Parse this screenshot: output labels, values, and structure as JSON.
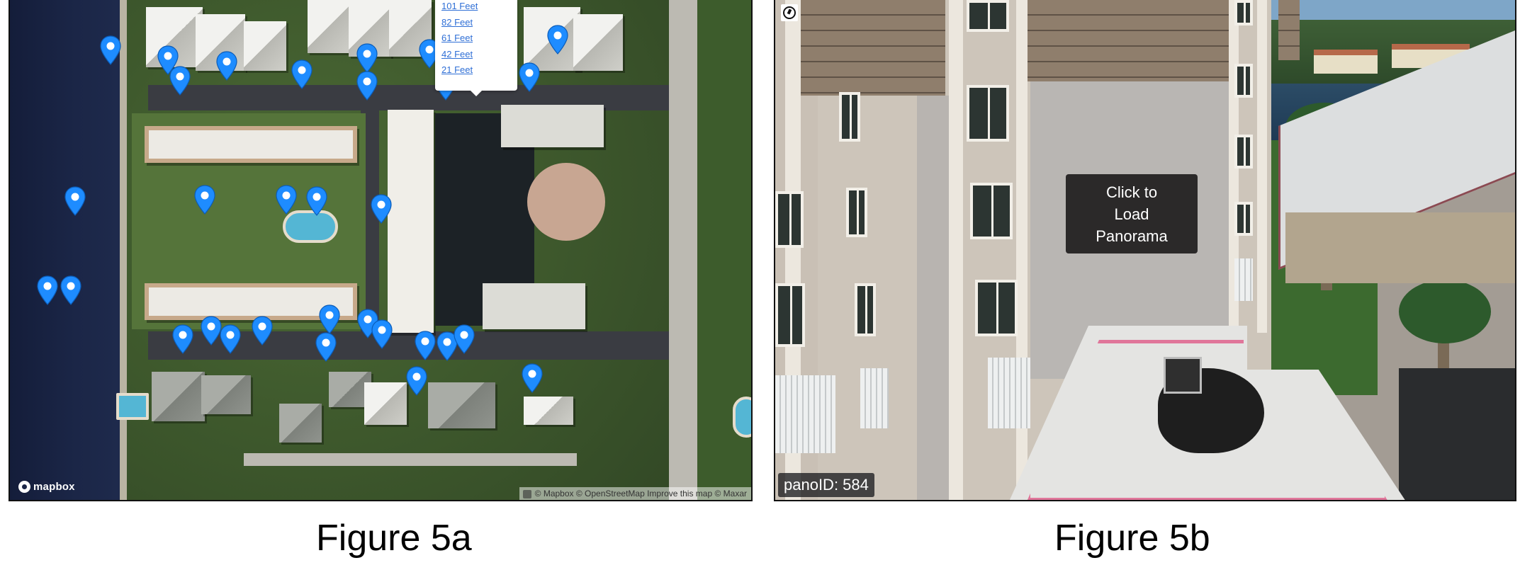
{
  "figure_a": {
    "caption": "Figure 5a",
    "map": {
      "marker_color": "#1e8cff",
      "marker_count": 31,
      "popup": {
        "links": [
          {
            "label": "101 Feet"
          },
          {
            "label": "82 Feet"
          },
          {
            "label": "61 Feet"
          },
          {
            "label": "42 Feet"
          },
          {
            "label": "21 Feet"
          }
        ]
      },
      "logo": {
        "icon": "mapbox-logo-icon",
        "label": "mapbox"
      },
      "attribution": {
        "info_icon": "info-icon",
        "parts": [
          "© Mapbox",
          "© OpenStreetMap",
          "Improve this map",
          "© Maxar"
        ],
        "text": "© Mapbox © OpenStreetMap Improve this map © Maxar"
      }
    }
  },
  "figure_b": {
    "caption": "Figure 5b",
    "panorama": {
      "compass_icon": "compass-icon",
      "load_button": {
        "lines": [
          "Click to",
          "Load",
          "Panorama"
        ]
      },
      "pano_id_label": "panoID: 584"
    }
  }
}
